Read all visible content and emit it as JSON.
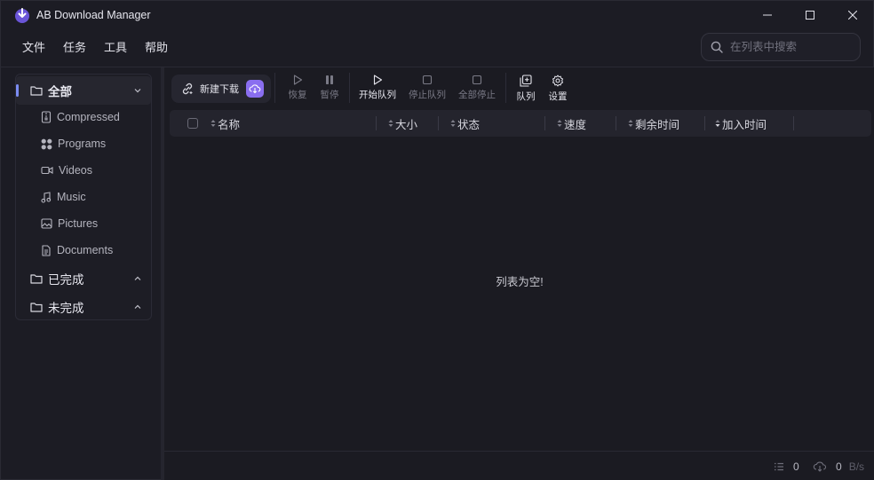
{
  "app": {
    "title": "AB Download Manager",
    "accent": "#8a6ef0"
  },
  "menu": [
    "文件",
    "任务",
    "工具",
    "帮助"
  ],
  "search": {
    "placeholder": "在列表中搜索",
    "value": ""
  },
  "sidebar": {
    "all": {
      "label": "全部",
      "expanded": true
    },
    "categories": [
      {
        "label": "Compressed",
        "icon": "archive-icon"
      },
      {
        "label": "Programs",
        "icon": "programs-icon"
      },
      {
        "label": "Videos",
        "icon": "video-icon"
      },
      {
        "label": "Music",
        "icon": "music-icon"
      },
      {
        "label": "Pictures",
        "icon": "picture-icon"
      },
      {
        "label": "Documents",
        "icon": "document-icon"
      }
    ],
    "finished": {
      "label": "已完成"
    },
    "unfinished": {
      "label": "未完成"
    }
  },
  "toolbar": {
    "new_download": "新建下载",
    "resume": "恢复",
    "pause": "暂停",
    "start_queue": "开始队列",
    "stop_queue": "停止队列",
    "stop_all": "全部停止",
    "queues": "队列",
    "settings": "设置"
  },
  "table": {
    "columns": [
      "名称",
      "大小",
      "状态",
      "速度",
      "剩余时间",
      "加入时间"
    ],
    "empty_message": "列表为空!"
  },
  "statusbar": {
    "count": "0",
    "speed": "0",
    "speed_unit": "B/s"
  }
}
